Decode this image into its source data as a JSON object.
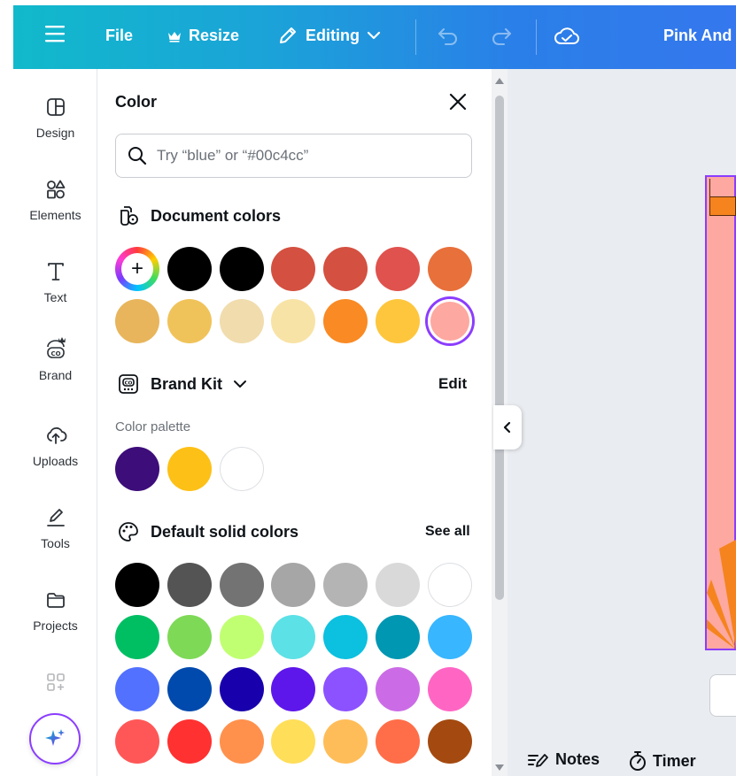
{
  "topbar": {
    "file_label": "File",
    "resize_label": "Resize",
    "editing_label": "Editing",
    "doc_title": "Pink And"
  },
  "rail": {
    "items": [
      {
        "label": "Design",
        "icon": "layout-icon"
      },
      {
        "label": "Elements",
        "icon": "shapes-icon"
      },
      {
        "label": "Text",
        "icon": "text-icon"
      },
      {
        "label": "Brand",
        "icon": "brand-icon"
      },
      {
        "label": "Uploads",
        "icon": "cloud-upload-icon"
      },
      {
        "label": "Tools",
        "icon": "pen-tool-icon"
      },
      {
        "label": "Projects",
        "icon": "folder-icon"
      }
    ]
  },
  "panel": {
    "title": "Color",
    "search_placeholder": "Try “blue” or “#00c4cc”",
    "document_colors": {
      "heading": "Document colors",
      "swatches": [
        "#000000",
        "#000000",
        "#d45040",
        "#d45040",
        "#e0524d",
        "#e8703a",
        "#e8b55c",
        "#f0c35a",
        "#f1dcae",
        "#f8e3a6",
        "#f98a24",
        "#fdc63d",
        "#fda8a0"
      ],
      "selected": "#fda8a0"
    },
    "brand_kit": {
      "heading": "Brand Kit",
      "edit_label": "Edit",
      "palette_label": "Color palette",
      "swatches": [
        "#3d0d7a",
        "#fdc016",
        "#ffffff"
      ]
    },
    "default_colors": {
      "heading": "Default solid colors",
      "see_all_label": "See all",
      "rows": [
        [
          "#000000",
          "#545454",
          "#737373",
          "#a6a6a6",
          "#b4b4b4",
          "#d9d9d9",
          "#ffffff"
        ],
        [
          "#00bf63",
          "#7ed957",
          "#c1ff72",
          "#5ce1e6",
          "#0cc0df",
          "#0097b2",
          "#38b6ff"
        ],
        [
          "#5271ff",
          "#004aad",
          "#1800ad",
          "#5e17eb",
          "#8c52ff",
          "#cb6ce6",
          "#ff66c4"
        ],
        [
          "#ff5757",
          "#ff3131",
          "#ff914d",
          "#ffde59",
          "#ffbd59",
          "#ff6e48",
          "#a44a10"
        ]
      ]
    }
  },
  "canvas": {
    "notes_label": "Notes",
    "timer_label": "Timer",
    "page_color": "#fda8a0"
  },
  "colors": {
    "accent": "#8b3dff",
    "topbar_start": "#11b9cb",
    "topbar_end": "#3577ee"
  }
}
